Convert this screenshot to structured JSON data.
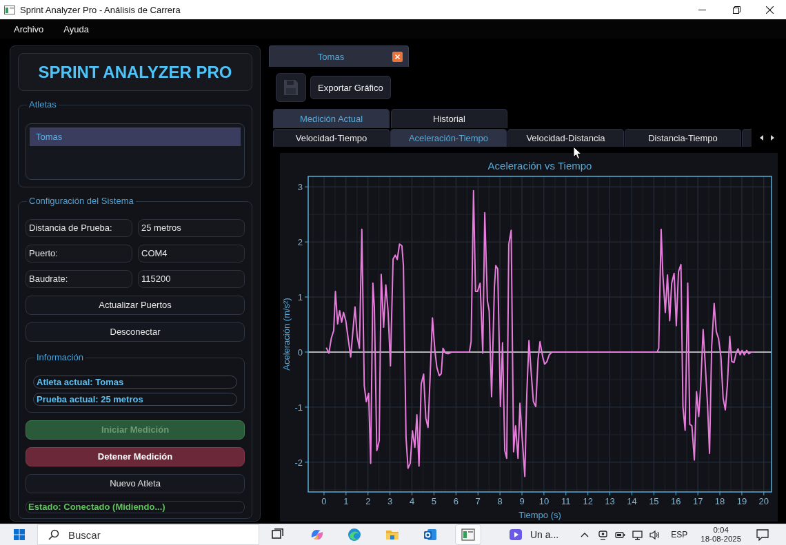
{
  "window": {
    "title": "Sprint Analyzer Pro - Análisis de Carrera"
  },
  "menu": [
    "Archivo",
    "Ayuda"
  ],
  "sidebar": {
    "app_title": "SPRINT ANALYZER PRO",
    "athletes": {
      "title": "Atletas",
      "items": [
        {
          "name": "Tomas",
          "selected": true
        }
      ]
    },
    "config": {
      "title": "Configuración del Sistema",
      "fields": [
        {
          "label": "Distancia de Prueba:",
          "value": "25 metros"
        },
        {
          "label": "Puerto:",
          "value": "COM4"
        },
        {
          "label": "Baudrate:",
          "value": "115200"
        }
      ],
      "buttons": [
        "Actualizar Puertos",
        "Desconectar"
      ],
      "info": {
        "title": "Información",
        "lines": [
          "Atleta actual: Tomas",
          "Prueba actual: 25 metros"
        ]
      },
      "actions": [
        {
          "label": "Iniciar Medición",
          "kind": "start",
          "disabled": true
        },
        {
          "label": "Detener Medición",
          "kind": "stop",
          "disabled": false
        },
        {
          "label": "Nuevo Atleta",
          "kind": "plain",
          "disabled": false
        }
      ],
      "status": "Estado: Conectado (Midiendo...)"
    }
  },
  "document_tab": {
    "label": "Tomas"
  },
  "toolbar": {
    "export_label": "Exportar Gráfico"
  },
  "view_tabs": [
    {
      "label": "Medición Actual",
      "selected": true
    },
    {
      "label": "Historial",
      "selected": false
    }
  ],
  "chart_tabs": [
    {
      "label": "Velocidad-Tiempo",
      "selected": false
    },
    {
      "label": "Aceleración-Tiempo",
      "selected": true
    },
    {
      "label": "Velocidad-Distancia",
      "selected": false
    },
    {
      "label": "Distancia-Tiempo",
      "selected": false
    }
  ],
  "chart": {
    "chart_data": {
      "type": "line",
      "title": "Aceleración vs Tiempo",
      "xlabel": "Tiempo (s)",
      "ylabel": "Aceleración (m/s²)",
      "grid": true,
      "x": [
        0.1,
        0.22,
        0.33,
        0.44,
        0.52,
        0.62,
        0.71,
        0.8,
        0.89,
        0.99,
        1.21,
        1.41,
        1.51,
        1.61,
        1.72,
        1.83,
        1.92,
        2.03,
        2.12,
        2.22,
        2.29,
        2.4,
        2.51,
        2.6,
        2.71,
        2.81,
        2.91,
        3.02,
        3.14,
        3.24,
        3.33,
        3.43,
        3.54,
        3.61,
        3.73,
        3.82,
        3.92,
        4.02,
        4.13,
        4.22,
        4.32,
        4.42,
        4.53,
        4.63,
        4.73,
        4.82,
        4.93,
        5.04,
        5.13,
        5.24,
        5.33,
        5.41,
        5.53,
        5.65,
        5.8,
        6.61,
        6.69,
        6.8,
        6.89,
        6.98,
        7.1,
        7.22,
        7.31,
        7.43,
        7.51,
        7.62,
        7.75,
        7.81,
        7.9,
        8.02,
        8.12,
        8.22,
        8.31,
        8.4,
        8.51,
        8.62,
        8.71,
        8.82,
        8.91,
        9.01,
        9.13,
        9.22,
        9.32,
        9.42,
        9.52,
        9.63,
        9.73,
        9.82,
        9.94,
        10.03,
        10.13,
        10.24,
        10.36,
        15.15,
        15.22,
        15.33,
        15.41,
        15.52,
        15.62,
        15.72,
        15.81,
        15.92,
        16.02,
        16.12,
        16.23,
        16.32,
        16.42,
        16.54,
        16.63,
        16.73,
        16.84,
        16.94,
        17.04,
        17.13,
        17.24,
        17.34,
        17.44,
        17.53,
        17.63,
        17.74,
        17.84,
        17.94,
        18.05,
        18.15,
        18.25,
        18.34,
        18.45,
        18.54,
        18.64,
        18.74,
        18.83,
        18.92,
        19.01,
        19.11,
        19.22,
        19.32,
        19.44,
        19.56
      ],
      "values": [
        0.08,
        -0.02,
        0.25,
        0.39,
        1.1,
        0.51,
        0.75,
        0.54,
        0.72,
        0.57,
        -0.09,
        0.82,
        0.28,
        0.07,
        2.23,
        -0.61,
        -0.9,
        -0.75,
        -2.02,
        1.25,
        0.81,
        -1.79,
        -1.61,
        1.41,
        0.45,
        1.22,
        0.75,
        -0.25,
        1.69,
        1.76,
        1.68,
        1.96,
        1.93,
        1.57,
        -1.55,
        -2.11,
        -2.02,
        -1.43,
        -1.73,
        -1.14,
        -2.07,
        -0.58,
        -0.4,
        -1.2,
        -1.37,
        -0.49,
        0.62,
        0.04,
        -0.28,
        -0.43,
        -0.39,
        0.07,
        -0.02,
        -0.03,
        0,
        0,
        0.19,
        2.93,
        1.1,
        1.1,
        1.25,
        -0.02,
        2.53,
        0.93,
        0.75,
        -0.81,
        1.19,
        1.57,
        1.51,
        -0.99,
        0.17,
        -1.79,
        -1.93,
        1.96,
        2.21,
        -1.81,
        -1.34,
        -1.93,
        -0.93,
        -1.55,
        -2.26,
        -0.78,
        0.21,
        -0.37,
        -0.9,
        -0.99,
        -0.14,
        0.19,
        -0.08,
        -0.22,
        -0.18,
        -0.05,
        0,
        0,
        0.07,
        2.23,
        1.4,
        0.72,
        1.4,
        0.57,
        1.25,
        1.43,
        0.48,
        1.46,
        1.59,
        -0.99,
        -1.42,
        1.25,
        -1.31,
        -1.34,
        -1.96,
        -0.72,
        -1.17,
        -0.61,
        0.41,
        -0.25,
        -0.96,
        -1.84,
        0.1,
        0.88,
        0.37,
        0.25,
        -0.08,
        -0.84,
        -1.05,
        -0.61,
        0.28,
        -0.17,
        -0.19,
        -0.02,
        0.06,
        -0.05,
        0.03,
        -0.05,
        0.03,
        -0.03,
        0,
        0
      ],
      "xlim": [
        -0.72,
        20.35
      ],
      "ylim": [
        -2.54,
        3.19
      ],
      "xticks": [
        0,
        1,
        2,
        3,
        4,
        5,
        6,
        7,
        8,
        9,
        10,
        11,
        12,
        13,
        14,
        15,
        16,
        17,
        18,
        19,
        20
      ],
      "yticks": [
        -2,
        -1,
        0,
        1,
        2,
        3
      ]
    }
  },
  "taskbar": {
    "search": {
      "placeholder": "Buscar"
    },
    "apps": [
      {
        "kind": "taskview",
        "active": false
      },
      {
        "kind": "swirl",
        "active": false
      },
      {
        "kind": "wave",
        "active": false
      },
      {
        "kind": "folder",
        "active": false
      },
      {
        "kind": "mail",
        "active": false
      },
      {
        "kind": "window",
        "active": true
      }
    ],
    "running": {
      "label": "Un a..."
    },
    "language": "ESP",
    "clock": {
      "time": "0:04",
      "date": "18-08-2025"
    }
  }
}
